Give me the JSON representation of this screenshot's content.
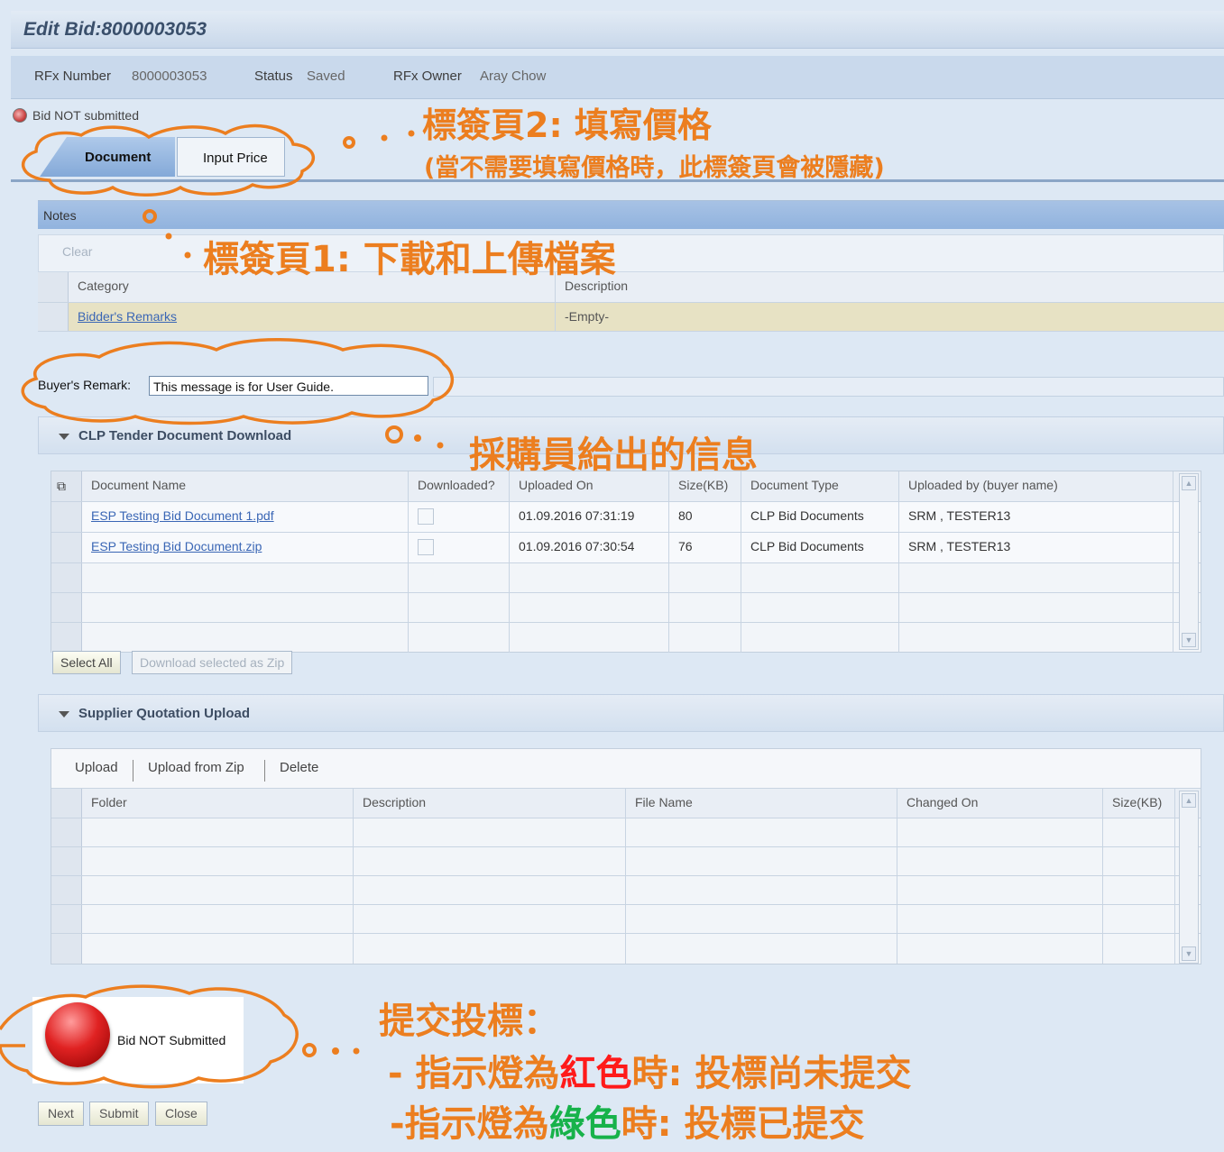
{
  "window": {
    "title": "Edit Bid:8000003053"
  },
  "info": {
    "rfx_number_label": "RFx Number",
    "rfx_number_value": "8000003053",
    "status_label": "Status",
    "status_value": "Saved",
    "owner_label": "RFx Owner",
    "owner_value": "Aray Chow"
  },
  "status_line": "Bid NOT submitted",
  "tabs": [
    {
      "label": "Document",
      "active": true
    },
    {
      "label": "Input Price",
      "active": false
    }
  ],
  "notes": {
    "title": "Notes",
    "clear_label": "Clear",
    "columns": [
      "Category",
      "Description"
    ],
    "rows": [
      {
        "category": "Bidder's Remarks",
        "description": "-Empty-"
      }
    ]
  },
  "buyer_remark": {
    "label": "Buyer's Remark:",
    "value": "This message is for User Guide."
  },
  "tender_section": {
    "title": "CLP Tender Document Download",
    "columns": [
      "Document Name",
      "Downloaded?",
      "Uploaded On",
      "Size(KB)",
      "Document Type",
      "Uploaded by (buyer name)"
    ],
    "rows": [
      {
        "name": "ESP Testing Bid Document 1.pdf",
        "downloaded": false,
        "uploaded_on": "01.09.2016 07:31:19",
        "size": "80",
        "type": "CLP Bid Documents",
        "by": "SRM , TESTER13"
      },
      {
        "name": "ESP Testing Bid Document.zip",
        "downloaded": false,
        "uploaded_on": "01.09.2016 07:30:54",
        "size": "76",
        "type": "CLP Bid Documents",
        "by": "SRM , TESTER13"
      }
    ],
    "select_all_label": "Select All",
    "download_zip_label": "Download selected as Zip"
  },
  "upload_section": {
    "title": "Supplier Quotation Upload",
    "toolbar": [
      "Upload",
      "Upload from Zip",
      "Delete"
    ],
    "columns": [
      "Folder",
      "Description",
      "File Name",
      "Changed On",
      "Size(KB)"
    ]
  },
  "submit_status": {
    "label": "Bid NOT Submitted",
    "light_color": "#e02222"
  },
  "bottom_buttons": [
    "Next",
    "Submit",
    "Close"
  ],
  "annotations": {
    "tab2_title": "標簽頁2: 填寫價格",
    "tab2_note": "(當不需要填寫價格時，此標簽頁會被隱藏)",
    "tab1_title": "標簽頁1: 下載和上傳檔案",
    "buyer_msg": "採購員給出的信息",
    "submit_title": "提交投標：",
    "red_prefix": "- 指示燈為",
    "red_word": "紅色",
    "red_suffix": "時: 投標尚未提交",
    "green_prefix": "-指示燈為",
    "green_word": "綠色",
    "green_suffix": "時: 投標已提交",
    "accent_color": "#ec7e1f"
  }
}
